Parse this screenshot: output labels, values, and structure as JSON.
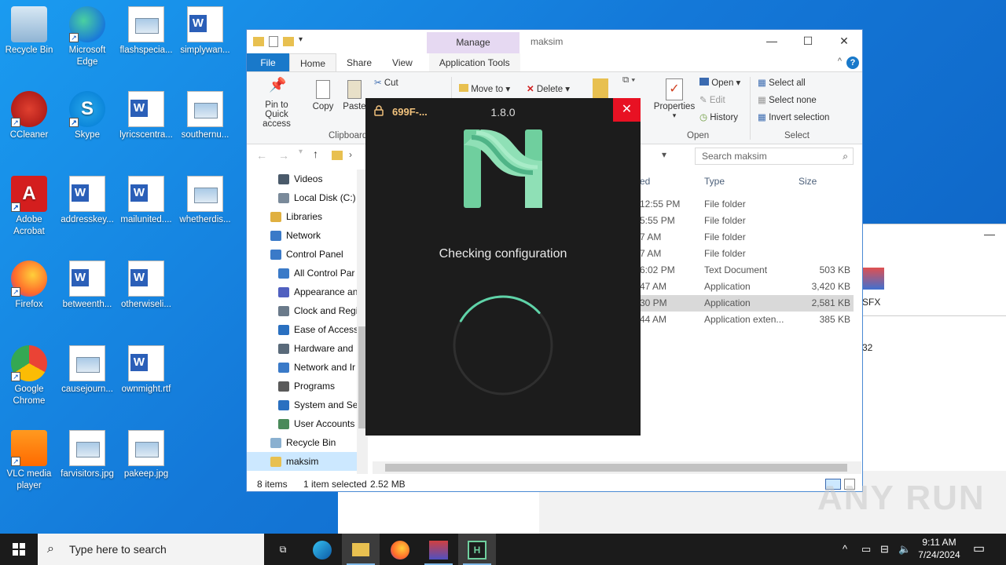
{
  "desktop_icons": [
    {
      "label": "Recycle Bin",
      "icon": "recycle-bin-icon"
    },
    {
      "label": "Microsoft Edge",
      "icon": "edge-icon"
    },
    {
      "label": "flashspecia...",
      "icon": "image-file-icon"
    },
    {
      "label": "simplywan...",
      "icon": "word-file-icon"
    },
    {
      "label": "CCleaner",
      "icon": "ccleaner-icon"
    },
    {
      "label": "Skype",
      "icon": "skype-icon"
    },
    {
      "label": "lyricscentra...",
      "icon": "word-file-icon"
    },
    {
      "label": "southernu...",
      "icon": "image-file-icon"
    },
    {
      "label": "Adobe Acrobat",
      "icon": "acrobat-icon"
    },
    {
      "label": "addresskey...",
      "icon": "word-file-icon"
    },
    {
      "label": "mailunited....",
      "icon": "word-file-icon"
    },
    {
      "label": "whetherdis...",
      "icon": "image-file-icon"
    },
    {
      "label": "Firefox",
      "icon": "firefox-icon"
    },
    {
      "label": "betweenth...",
      "icon": "word-file-icon"
    },
    {
      "label": "otherwiseli...",
      "icon": "word-file-icon"
    },
    {
      "label": "Google Chrome",
      "icon": "chrome-icon"
    },
    {
      "label": "causejourn...",
      "icon": "image-file-icon"
    },
    {
      "label": "ownmight.rtf",
      "icon": "word-file-icon"
    },
    {
      "label": "VLC media player",
      "icon": "vlc-icon"
    },
    {
      "label": "farvisitors.jpg",
      "icon": "image-file-icon"
    },
    {
      "label": "pakeep.jpg",
      "icon": "image-file-icon"
    }
  ],
  "explorer": {
    "title": "maksim",
    "manage_tab": "Manage",
    "tabs": {
      "file": "File",
      "home": "Home",
      "share": "Share",
      "view": "View",
      "app_tools": "Application Tools"
    },
    "ribbon": {
      "pin": "Pin to Quick access",
      "copy": "Copy",
      "paste": "Paste",
      "cut": "Cut",
      "clipboard": "Clipboard",
      "move_to": "Move to",
      "delete": "Delete",
      "properties": "Properties",
      "open": "Open",
      "edit": "Edit",
      "history": "History",
      "open_group": "Open",
      "select_all": "Select all",
      "select_none": "Select none",
      "invert_selection": "Invert selection",
      "select_group": "Select"
    },
    "search_placeholder": "Search maksim",
    "nav_items": [
      {
        "label": "Videos",
        "color": "#4a5a6a",
        "indent": 1
      },
      {
        "label": "Local Disk (C:)",
        "color": "#7a8a9a",
        "indent": 1
      },
      {
        "label": "Libraries",
        "color": "#e0b040",
        "indent": 0
      },
      {
        "label": "Network",
        "color": "#3a7ac8",
        "indent": 0
      },
      {
        "label": "Control Panel",
        "color": "#3a7ac8",
        "indent": 0
      },
      {
        "label": "All Control Par",
        "color": "#3a7ac8",
        "indent": 1
      },
      {
        "label": "Appearance an",
        "color": "#5060c0",
        "indent": 1
      },
      {
        "label": "Clock and Regi",
        "color": "#6a7a8a",
        "indent": 1
      },
      {
        "label": "Ease of Access",
        "color": "#2a70c0",
        "indent": 1
      },
      {
        "label": "Hardware and",
        "color": "#5a6a7a",
        "indent": 1
      },
      {
        "label": "Network and Ir",
        "color": "#3a7ac8",
        "indent": 1
      },
      {
        "label": "Programs",
        "color": "#5a5a5a",
        "indent": 1
      },
      {
        "label": "System and Sec",
        "color": "#2a70c0",
        "indent": 1
      },
      {
        "label": "User Accounts",
        "color": "#4a8a5a",
        "indent": 1
      },
      {
        "label": "Recycle Bin",
        "color": "#8ab0d0",
        "indent": 0
      },
      {
        "label": "maksim",
        "color": "#e8c050",
        "indent": 0,
        "selected": true
      }
    ],
    "columns": {
      "date": "ed",
      "type": "Type",
      "size": "Size"
    },
    "rows": [
      {
        "date": "12:55 PM",
        "type": "File folder",
        "size": ""
      },
      {
        "date": "5:55 PM",
        "type": "File folder",
        "size": ""
      },
      {
        "date": "7 AM",
        "type": "File folder",
        "size": ""
      },
      {
        "date": "7 AM",
        "type": "File folder",
        "size": ""
      },
      {
        "date": "6:02 PM",
        "type": "Text Document",
        "size": "503 KB"
      },
      {
        "date": "47 AM",
        "type": "Application",
        "size": "3,420 KB"
      },
      {
        "date": "30 PM",
        "type": "Application",
        "size": "2,581 KB",
        "selected": true
      },
      {
        "date": "44 AM",
        "type": "Application exten...",
        "size": "385 KB"
      }
    ],
    "status": {
      "items": "8 items",
      "selected": "1 item selected",
      "size": "2.52 MB"
    }
  },
  "second_window": {
    "label": "SFX",
    "value": "32"
  },
  "dialog": {
    "title": "699F-...",
    "version": "1.8.0",
    "status": "Checking configuration",
    "progress": 0.3,
    "accent": "#5fd3a8"
  },
  "taskbar": {
    "search_placeholder": "Type here to search",
    "time": "9:11 AM",
    "date": "7/24/2024"
  },
  "watermark": "ANY RUN"
}
